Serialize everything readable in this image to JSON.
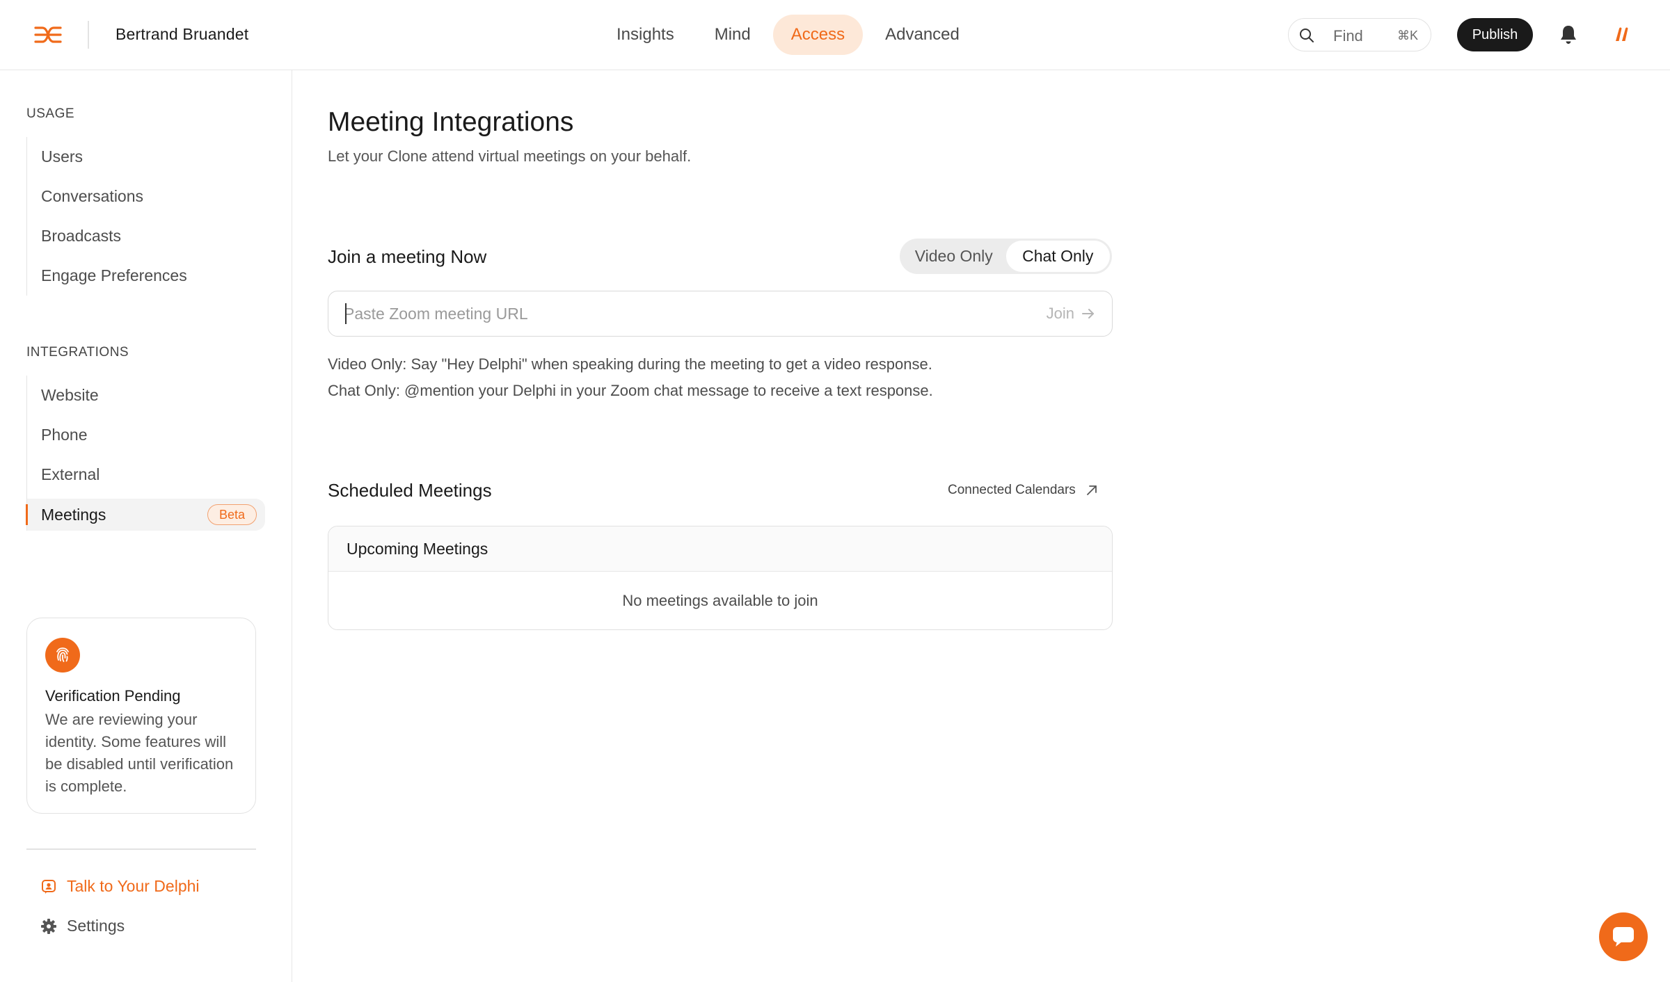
{
  "header": {
    "user_name": "Bertrand Bruandet",
    "nav": [
      {
        "label": "Insights",
        "active": false
      },
      {
        "label": "Mind",
        "active": false
      },
      {
        "label": "Access",
        "active": true
      },
      {
        "label": "Advanced",
        "active": false
      }
    ],
    "search_label": "Find",
    "search_shortcut": "⌘K",
    "publish_label": "Publish"
  },
  "sidebar": {
    "usage_label": "USAGE",
    "usage_items": [
      "Users",
      "Conversations",
      "Broadcasts",
      "Engage Preferences"
    ],
    "integrations_label": "INTEGRATIONS",
    "integration_items": [
      "Website",
      "Phone",
      "External",
      "Meetings"
    ],
    "active_item": "Meetings",
    "beta_badge": "Beta",
    "verification": {
      "title": "Verification Pending",
      "text": "We are reviewing your identity. Some features will be disabled until verification is complete."
    },
    "talk_link": "Talk to Your Delphi",
    "settings_link": "Settings"
  },
  "main": {
    "title": "Meeting Integrations",
    "subtitle": "Let your Clone attend virtual meetings on your behalf.",
    "join": {
      "title": "Join a meeting Now",
      "modes": [
        "Video Only",
        "Chat Only"
      ],
      "selected_mode": "Chat Only",
      "url_placeholder": "Paste Zoom meeting URL",
      "url_value": "",
      "join_label": "Join",
      "help_video": "Video Only: Say \"Hey Delphi\" when speaking during the meeting to get a video response.",
      "help_chat": "Chat Only: @mention your Delphi in your Zoom chat message to receive a text response."
    },
    "scheduled": {
      "title": "Scheduled Meetings",
      "connected_label": "Connected Calendars",
      "table_header": "Upcoming Meetings",
      "empty_text": "No meetings available to join"
    }
  },
  "colors": {
    "accent": "#f06a1a",
    "accent_bg": "#fde8d8",
    "dark": "#1a1a1a"
  },
  "icons": [
    "delphi-logo-icon",
    "search-icon",
    "bell-icon",
    "brand-mark-icon",
    "fingerprint-icon",
    "chat-icon",
    "gear-icon",
    "arrow-right-icon",
    "arrow-up-right-icon",
    "chat-bubble-icon"
  ]
}
